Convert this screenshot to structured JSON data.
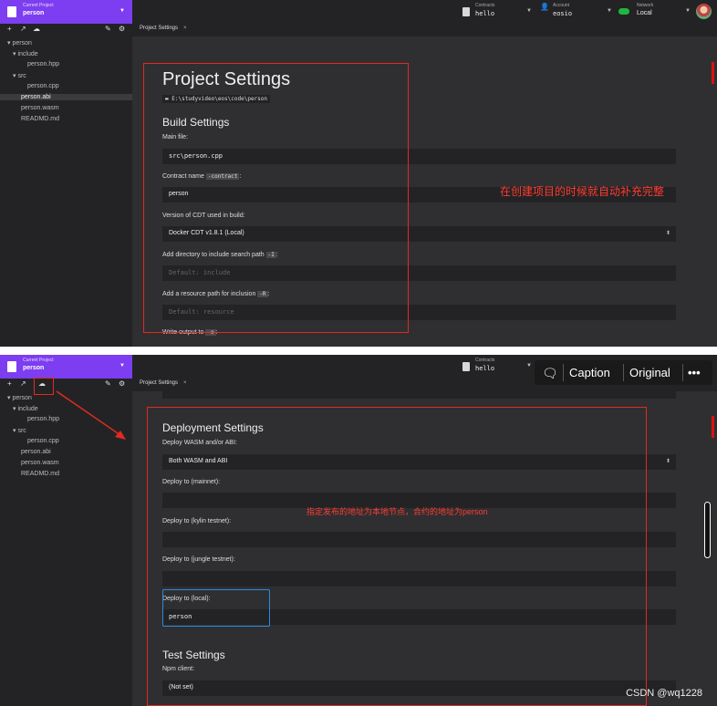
{
  "topbar": {
    "project_caption": "Current Project",
    "project_value": "person",
    "contracts_caption": "Contracts",
    "contracts_value": "hello",
    "account_caption": "Account",
    "account_value": "eosio",
    "network_caption": "Network",
    "network_value": "Local"
  },
  "sidebar": {
    "tree": [
      "person",
      "include",
      "person.hpp",
      "src",
      "person.cpp",
      "person.abi",
      "person.wasm",
      "READMD.md"
    ]
  },
  "tab": {
    "label": "Project Settings",
    "close": "×"
  },
  "screen1": {
    "title": "Project Settings",
    "path": "E:\\studyvideo\\eos\\code\\person",
    "build_heading": "Build Settings",
    "main_file_label": "Main file:",
    "main_file_value": "src\\person.cpp",
    "contract_name_label": "Contract name",
    "contract_flag": "-contract",
    "contract_name_value": "person",
    "cdt_label": "Version of CDT used in build:",
    "cdt_value": "Docker CDT v1.8.1 (Local)",
    "include_label": "Add directory to include search path",
    "include_flag": "-I",
    "include_placeholder": "Default: include",
    "resource_label": "Add a resource path for inclusion",
    "resource_flag": "-R",
    "resource_placeholder": "Default: resource",
    "write_output_label": "Write output to",
    "write_output_flag": "-o",
    "annotation": "在创建项目的时候就自动补充完整"
  },
  "screen2": {
    "deploy_heading": "Deployment Settings",
    "deploy_wasm_label": "Deploy WASM and/or ABI:",
    "deploy_wasm_value": "Both WASM and ABI",
    "mainnet_label": "Deploy to (mainnet):",
    "kylin_label": "Deploy to (kylin testnet):",
    "jungle_label": "Deploy to (jungle testnet):",
    "local_label": "Deploy to (local):",
    "local_value": "person",
    "test_heading": "Test Settings",
    "npm_label": "Npm client:",
    "npm_value": "(Not set)",
    "annotation": "指定发布的地址为本地节点，合约的地址为person"
  },
  "overlay": {
    "caption": "Caption",
    "original": "Original",
    "more": "•••"
  },
  "watermark": "CSDN @wq1228",
  "colors": {
    "accent": "#7d3df0",
    "annotation": "#e02b20",
    "highlight": "#2b8be0",
    "network_on": "#1fb83d"
  }
}
